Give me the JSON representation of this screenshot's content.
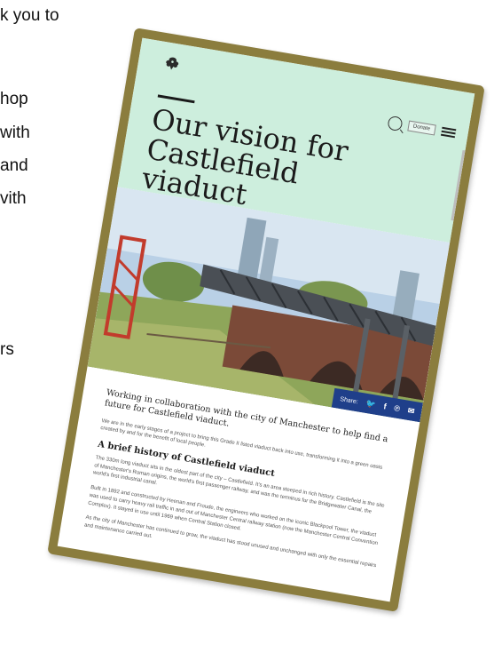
{
  "slide_fragments": [
    "k you to",
    "hop",
    "with",
    "and",
    "vith",
    "rs"
  ],
  "site": {
    "logo_icon": "oak-leaf-icon",
    "search_icon": "search-icon",
    "donate_label": "Donate",
    "menu_icon": "hamburger-menu-icon"
  },
  "page": {
    "title": "Our vision for Castlefield viaduct"
  },
  "share": {
    "label": "Share:",
    "twitter": "🐦",
    "facebook": "f",
    "pinterest": "℗",
    "email": "✉"
  },
  "article": {
    "lead": "Working in collaboration with the city of Manchester to help find a future for Castlefield viaduct.",
    "intro": "We are in the early stages of a project to bring this Grade II listed viaduct back into use, transforming it into a green oasis created by and for the benefit of local people.",
    "history_heading": "A brief history of Castlefield viaduct",
    "history_p1": "The 330m long viaduct sits in the oldest part of the city – Castlefield. It's an area steeped in rich history. Castlefield is the site of Manchester's Roman origins, the world's first passenger railway, and was the terminus for the Bridgewater Canal, the world's first industrial canal.",
    "history_p2": "Built in 1892 and constructed by Heenan and Froude, the engineers who worked on the iconic Blackpool Tower, the viaduct was used to carry heavy rail traffic in and out of Manchester Central railway station (now the Manchester Central Convention Complex). It stayed in use until 1969 when Central Station closed.",
    "history_p3": "As the city of Manchester has continued to grow, the viaduct has stood unused and unchanged with only the essential repairs and maintenance carried out."
  },
  "colors": {
    "frame": "#8b7d3e",
    "hero_bg": "#cdeedd",
    "share_bar": "#1f3f8a"
  }
}
